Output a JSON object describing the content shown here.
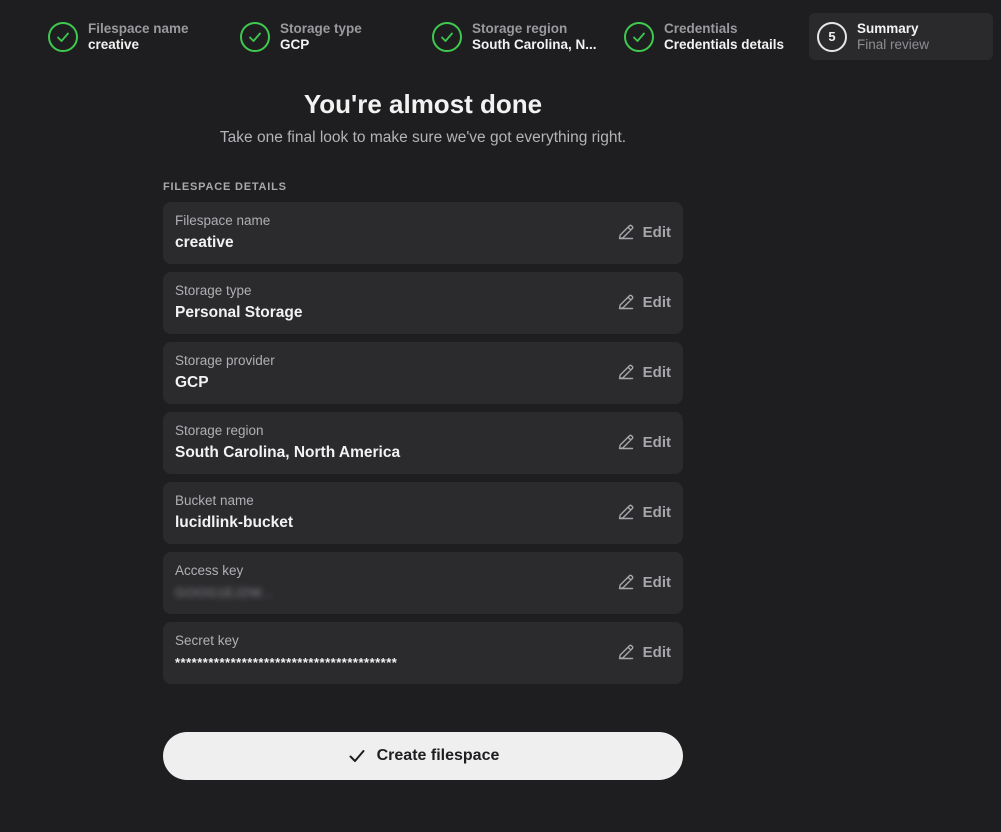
{
  "stepper": {
    "steps": [
      {
        "title": "Filespace name",
        "sub": "creative",
        "state": "done"
      },
      {
        "title": "Storage type",
        "sub": "GCP",
        "state": "done"
      },
      {
        "title": "Storage region",
        "sub": "South Carolina, N...",
        "state": "done"
      },
      {
        "title": "Credentials",
        "sub": "Credentials details",
        "state": "done"
      },
      {
        "title": "Summary",
        "sub": "Final review",
        "state": "current",
        "number": "5"
      }
    ]
  },
  "main": {
    "heading": "You're almost done",
    "subheading": "Take one final look to make sure we've got everything right.",
    "section_label": "FILESPACE DETAILS",
    "edit_label": "Edit",
    "fields": [
      {
        "label": "Filespace name",
        "value": "creative"
      },
      {
        "label": "Storage type",
        "value": "Personal Storage"
      },
      {
        "label": "Storage provider",
        "value": "GCP"
      },
      {
        "label": "Storage region",
        "value": "South Carolina, North America"
      },
      {
        "label": "Bucket name",
        "value": "lucidlink-bucket"
      },
      {
        "label": "Access key",
        "value": "GOOG1EJ2W...",
        "redacted": true
      },
      {
        "label": "Secret key",
        "value": "****************************************"
      }
    ],
    "create_button": "Create filespace"
  },
  "colors": {
    "background": "#1e1e20",
    "card": "#2b2b2e",
    "success": "#3ec94f",
    "button": "#efeff0"
  }
}
